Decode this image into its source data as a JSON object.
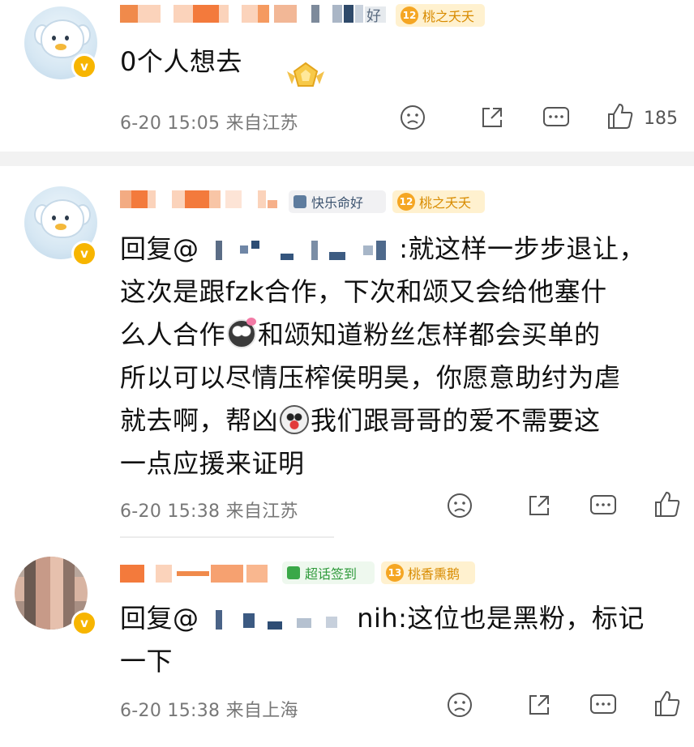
{
  "comments": [
    {
      "text": "0个人想去",
      "time": "6-20 15:05",
      "location": "来自江苏",
      "like_count": "185",
      "tags": {
        "fan_badge": "桃之夭夭",
        "fan_level": "12"
      }
    },
    {
      "tags": {
        "badge": "快乐命好",
        "fan_badge": "桃之夭夭",
        "fan_level": "12"
      },
      "reply_prefix": "回复",
      "at": "@",
      "line1_tail": ":就这样一步步退让，",
      "line2": "这次是跟fzk合作，下次和颂又会给他塞什",
      "line3_a": "么人合作",
      "line3_b": "和颂知道粉丝怎样都会买单的",
      "line4": "所以可以尽情压榨侯明昊，你愿意助纣为虐",
      "line5_a": "就去啊，帮凶",
      "line5_b": "我们跟哥哥的爱不需要这",
      "line6": "一点应援来证明",
      "time": "6-20 15:38",
      "location": "来自江苏"
    },
    {
      "tags": {
        "badge": "超话签到",
        "fan_badge": "桃香熏鹅",
        "fan_level": "13"
      },
      "reply_prefix": "回复",
      "at": "@",
      "line1_tail": "nih:这位也是黑粉，标记",
      "line2": "一下",
      "time": "6-20 15:38",
      "location": "来自上海"
    }
  ],
  "top_name_fragment": "好",
  "icons": {
    "verified": "verified-v-badge-icon",
    "dislike": "sad-face-icon",
    "share": "share-icon",
    "comment": "comment-bubble-icon",
    "like": "thumbs-up-icon"
  },
  "verified_glyph": "v",
  "colors": {
    "accent": "#f7b500",
    "name_blur": "#f08a4b",
    "meta": "#777777"
  }
}
